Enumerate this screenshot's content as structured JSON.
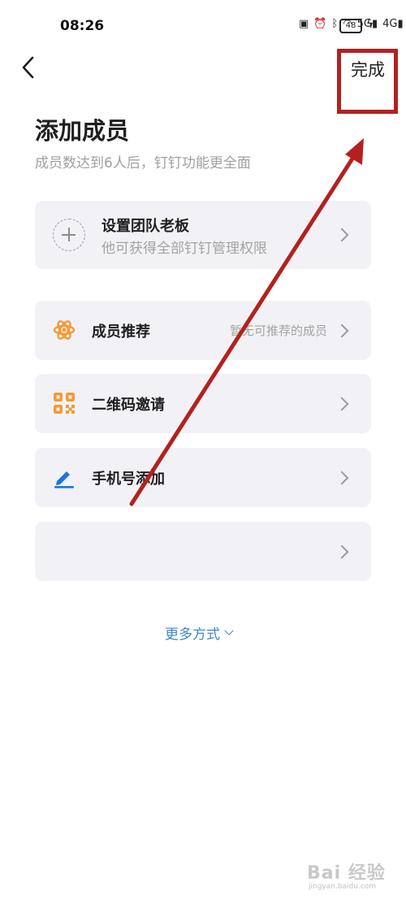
{
  "status_bar": {
    "time": "08:26",
    "icons": [
      "nfc-icon",
      "alarm-icon",
      "bluetooth-icon",
      "wifi-icon",
      "hd-icon",
      "signal-5g-icon",
      "signal-4g-icon"
    ],
    "network_labels": [
      "5G",
      "4G"
    ],
    "battery": "48"
  },
  "header": {
    "done_label": "完成"
  },
  "page": {
    "title": "添加成员",
    "subtitle": "成员数达到6人后，钉钉功能更全面"
  },
  "boss_card": {
    "title": "设置团队老板",
    "description": "他可获得全部钉钉管理权限"
  },
  "options": [
    {
      "label": "成员推荐",
      "hint": "暂无可推荐的成员",
      "icon": "atom-recommend-icon"
    },
    {
      "label": "二维码邀请",
      "hint": "",
      "icon": "qr-code-icon"
    },
    {
      "label": "手机号添加",
      "hint": "",
      "icon": "pen-icon"
    },
    {
      "label": "",
      "hint": "",
      "icon": ""
    }
  ],
  "more_ways_label": "更多方式",
  "watermark": {
    "brand": "Bai 经验",
    "url": "jingyan.baidu.com"
  },
  "colors": {
    "accent_orange": "#f29a38",
    "accent_blue": "#1a73e8",
    "link_blue": "#3f87c8",
    "annotation_red": "#b3211e",
    "card_bg": "#f2f2f6"
  }
}
